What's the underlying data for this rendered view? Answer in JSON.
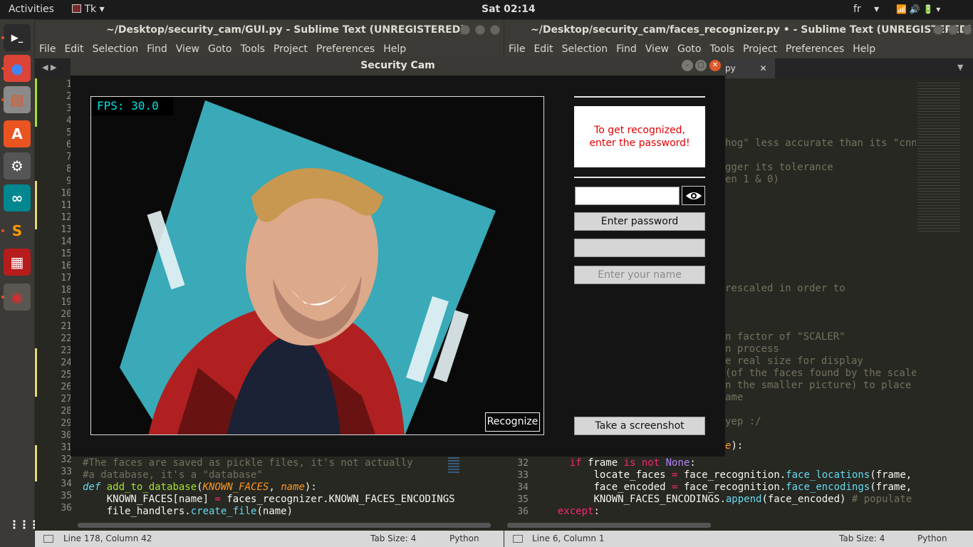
{
  "topbar": {
    "activities": "Activities",
    "app": "Tk",
    "app_arrow": "▾",
    "clock": "Sat 02:14",
    "lang": "fr",
    "lang_arrow": "▾",
    "status_icons": "📶 🔊 🔋 ▾"
  },
  "launcher": [
    {
      "icon": "terminal-icon",
      "glyph": "▶_",
      "bg": "#2b2b2b",
      "fg": "#ffffff"
    },
    {
      "icon": "chrome-icon",
      "glyph": "●",
      "bg": "#db4437",
      "fg": "#4285f4"
    },
    {
      "icon": "files-icon",
      "glyph": "▤",
      "bg": "#8a8a8a",
      "fg": "#e95420"
    },
    {
      "icon": "software-center-icon",
      "glyph": "A",
      "bg": "#e95420",
      "fg": "#ffffff"
    },
    {
      "icon": "settings-icon",
      "glyph": "⚙",
      "bg": "#555555",
      "fg": "#ffffff"
    },
    {
      "icon": "arduino-icon",
      "glyph": "∞",
      "bg": "#00878f",
      "fg": "#ffffff"
    },
    {
      "icon": "sublime-icon",
      "glyph": "S",
      "bg": "#3c3a37",
      "fg": "#ff9800"
    },
    {
      "icon": "screen-recorder-icon",
      "glyph": "▦",
      "bg": "#b71c1c",
      "fg": "#ffffff"
    },
    {
      "icon": "tk-app-icon",
      "glyph": "◉",
      "bg": "#5a5752",
      "fg": "#d32f2f"
    }
  ],
  "launcher_apps": "⋮⋮⋮",
  "left_editor": {
    "title": "~/Desktop/security_cam/GUI.py - Sublime Text (UNREGISTERED)",
    "menu": [
      "File",
      "Edit",
      "Selection",
      "Find",
      "View",
      "Goto",
      "Tools",
      "Project",
      "Preferences",
      "Help"
    ],
    "line_numbers": [
      "1",
      "2",
      "3",
      "4",
      "5",
      "6",
      "7",
      "8",
      "9",
      "10",
      "11",
      "12",
      "13",
      "14",
      "15",
      "16",
      "17",
      "18",
      "19",
      "20",
      "21",
      "22",
      "23",
      "24",
      "25",
      "26",
      "27",
      "28",
      "29",
      "30",
      "31",
      "32",
      "33",
      "34",
      "35",
      "36"
    ],
    "code": {
      "l32": "#The faces are saved as pickle files, it's not actually",
      "l33": "#a database, it's a \"database\"",
      "l34_def": "def",
      "l34_name": "add_to_database",
      "l34_p1": "(",
      "l34_a1": "KNOWN_FACES",
      "l34_p2": ", ",
      "l34_a2": "name",
      "l34_p3": "):",
      "l35_a": "    KNOWN_FACES[name] ",
      "l35_op": "=",
      "l35_b": " faces_recognizer.KNOWN_FACES_ENCODINGS",
      "l36_a": "    file_handlers.",
      "l36_fn": "create_file",
      "l36_b": "(name)"
    },
    "status_pos": "Line 178, Column 42",
    "status_tab": "Tab Size: 4",
    "status_lang": "Python"
  },
  "right_editor": {
    "title": "~/Desktop/security_cam/faces_recognizer.py • - Sublime Text (UNREGISTERED)",
    "menu": [
      "File",
      "Edit",
      "Selection",
      "Find",
      "View",
      "Goto",
      "Tools",
      "Project",
      "Preferences",
      "Help"
    ],
    "tab_label": "py",
    "tab_close": "✕",
    "line_numbers": [
      "32",
      "33",
      "34",
      "35",
      "36"
    ],
    "code": {
      "f1": "hog\" less accurate than its \"cnn\"",
      "f2": "gger its tolerance",
      "f3": "en 1 & 0)",
      "f4": "rescaled in order to",
      "f5": "n factor of \"SCALER\"",
      "f6": "n process",
      "f7": "e real size for display",
      "f8": "(of the faces found by the scaler",
      "f9": "n the smaller picture) to place",
      "f10": "ame",
      "f11": "yep :/",
      "f12_st": "e",
      "f12_b": "):",
      "l32_kw": "if",
      "l32_a": " frame ",
      "l32_op": "is not",
      "l32_sp": " ",
      "l32_cn": "None",
      "l32_b": ":",
      "l33_a": "locate_faces ",
      "l33_op": "=",
      "l33_b": " face_recognition.",
      "l33_fn": "face_locations",
      "l33_c": "(frame,",
      "l34_a": "face_encoded ",
      "l34_op": "=",
      "l34_b": " face_recognition.",
      "l34_fn": "face_encodings",
      "l34_c": "(frame,",
      "l35_a": "KNOWN_FACES_ENCODINGS.",
      "l35_fn": "append",
      "l35_b": "(face_encoded) ",
      "l35_cm": "# populate",
      "l36_kw": "except",
      "l36_b": ":"
    },
    "status_pos": "Line 6, Column 1",
    "status_tab": "Tab Size: 4",
    "status_lang": "Python"
  },
  "tk_window": {
    "title": "Security Cam",
    "minimize": "–",
    "maximize": "▢",
    "close": "✕",
    "fps": "FPS: 30.0",
    "recognize_button": "Recognize",
    "message": "To get recognized, enter the password!",
    "password_value": "",
    "eye_icon_glyph": "👁",
    "enter_password_button": "Enter password",
    "name_field_value": "",
    "name_placeholder": "Enter your name",
    "screenshot_button": "Take a screenshot",
    "message_color": "#e00000"
  }
}
